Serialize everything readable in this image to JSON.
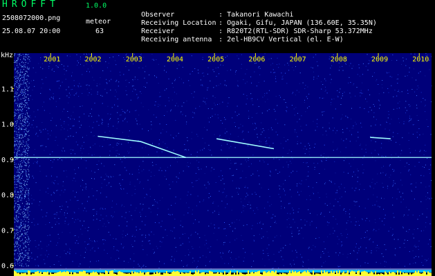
{
  "header": {
    "logo": "HROFFT",
    "version": "1.0.0",
    "filename": "2508072000.png",
    "datetime": "25.08.07 20:00",
    "meteor_label": "meteor",
    "meteor_count": "63",
    "info": [
      {
        "key": "Observer",
        "value": ": Takanori Kawachi"
      },
      {
        "key": "Receiving Location",
        "value": ": Ogaki, Gifu, JAPAN (136.60E, 35.35N)"
      },
      {
        "key": "Receiver",
        "value": ": R820T2(RTL-SDR) SDR-Sharp 53.372MHz"
      },
      {
        "key": "Receiving antenna",
        "value": ": 2el-HB9CV Vertical (el. E-W)"
      }
    ]
  },
  "colors": {
    "background": "#000000",
    "plot": "#00007a",
    "text_green": "#00ff66",
    "text_white": "#ffffff",
    "tick_yellow": "#ffff00",
    "signal_cyan": "#9ffcff",
    "noise_yellow": "#ffff33",
    "bottom_band": "#00b8ff"
  },
  "chart_data": {
    "type": "heatmap",
    "ylabel": "kHz",
    "y_ticks": [
      "1.1",
      "1.0",
      "0.9",
      "0.8",
      "0.7",
      "0.6"
    ],
    "x_ticks": [
      "2001",
      "2002",
      "2003",
      "2004",
      "2005",
      "2006",
      "2007",
      "2008",
      "2009",
      "2010"
    ],
    "ylim": [
      0.58,
      1.2
    ],
    "xlim": [
      2000.1,
      2010.3
    ],
    "carrier_khz": 0.905,
    "meteor_traces": [
      {
        "x": [
          2002.15,
          2003.2,
          2004.3
        ],
        "y": [
          0.965,
          0.95,
          0.905
        ]
      },
      {
        "x": [
          2005.05,
          2006.45
        ],
        "y": [
          0.958,
          0.93
        ]
      },
      {
        "x": [
          2008.8,
          2009.3
        ],
        "y": [
          0.962,
          0.958
        ]
      }
    ]
  }
}
